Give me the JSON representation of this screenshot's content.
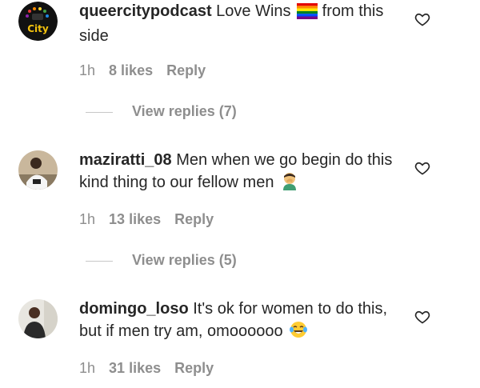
{
  "comments": [
    {
      "username": "queercitypodcast",
      "text_before": "Love Wins",
      "emoji1": "rainbow-flag",
      "text_after": "from this side",
      "time": "1h",
      "likes": "8 likes",
      "reply": "Reply",
      "view_replies": "View replies (7)"
    },
    {
      "username": "maziratti_08",
      "text_before": "Men when we go begin do this kind thing to our fellow men",
      "emoji1": "facepalm",
      "time": "1h",
      "likes": "13 likes",
      "reply": "Reply",
      "view_replies": "View replies (5)"
    },
    {
      "username": "domingo_loso",
      "text_before": "It's ok for women to do this, but if men try am, omoooooo",
      "emoji1": "tears-of-joy",
      "time": "1h",
      "likes": "31 likes",
      "reply": "Reply"
    }
  ],
  "avatar_labels": {
    "first": "City"
  },
  "colors": {
    "text": "#262626",
    "muted": "#8e8e8e",
    "divider": "#c7c7c7"
  }
}
